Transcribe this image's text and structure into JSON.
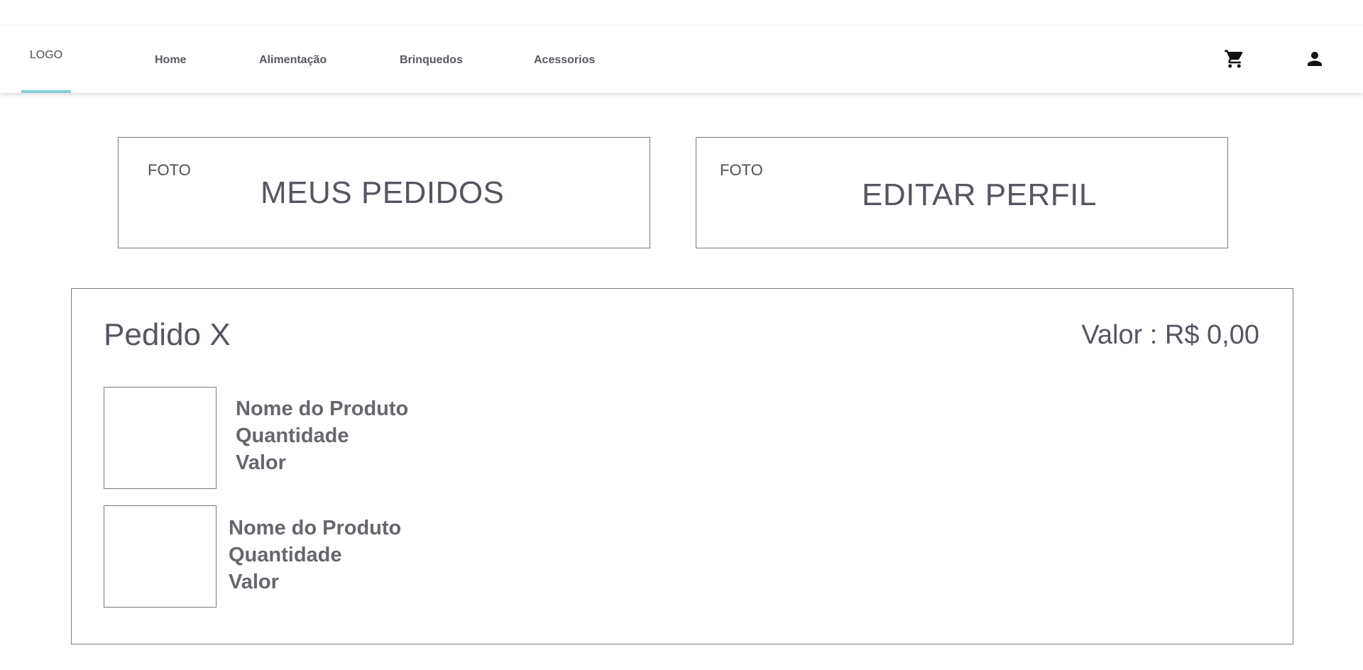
{
  "navbar": {
    "logo": "LOGO",
    "links": [
      "Home",
      "Alimentação",
      "Brinquedos",
      "Acessorios"
    ],
    "icons": [
      "cart-icon",
      "user-icon"
    ],
    "accent_color": "#85d0d6"
  },
  "cards": {
    "orders": {
      "foto": "FOTO",
      "title": "MEUS PEDIDOS"
    },
    "profile": {
      "foto": "FOTO",
      "title": "EDITAR PERFIL"
    }
  },
  "order": {
    "title": "Pedido X",
    "value": "Valor : R$ 0,00",
    "items": [
      {
        "name": "Nome do Produto",
        "quantity": "Quantidade",
        "value": "Valor"
      },
      {
        "name": "Nome do Produto",
        "quantity": "Quantidade",
        "value": "Valor"
      }
    ]
  }
}
